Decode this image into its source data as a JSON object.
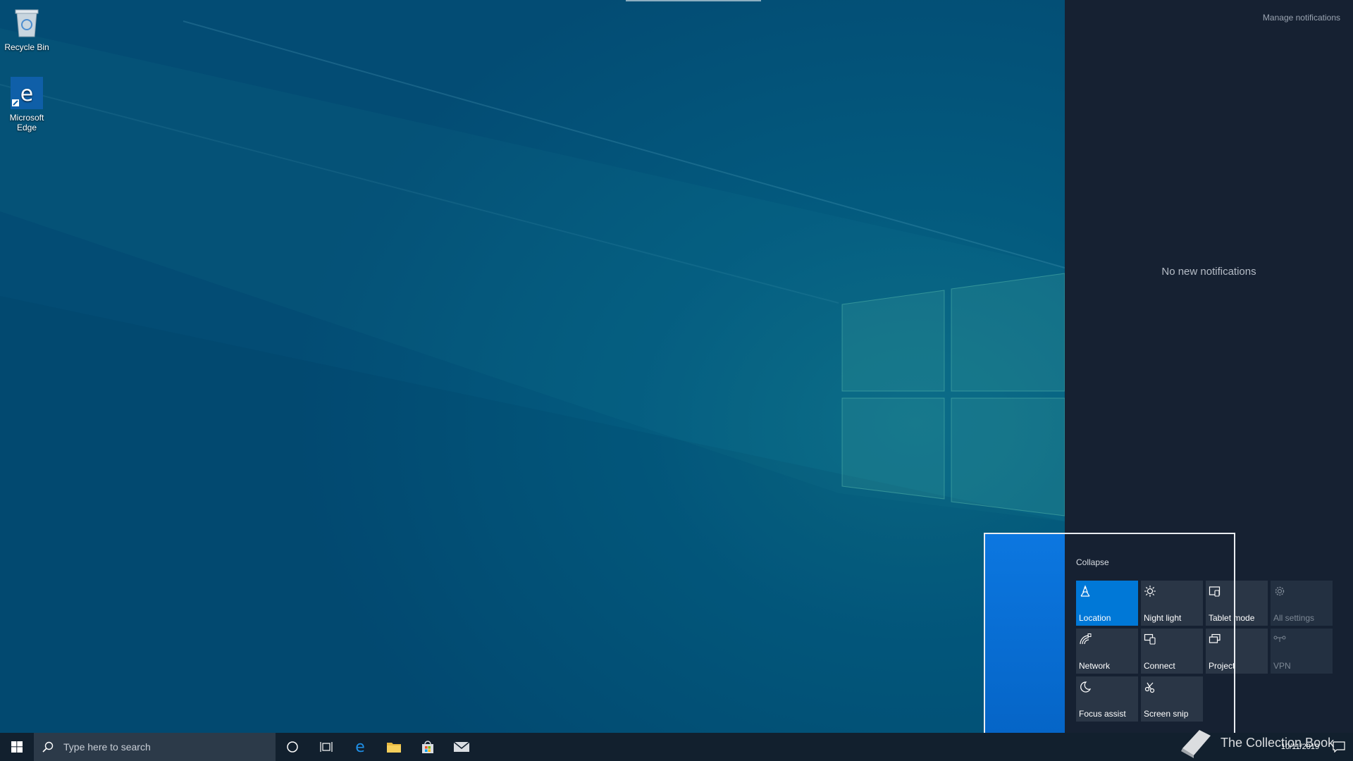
{
  "desktop": {
    "icons": [
      {
        "label": "Recycle Bin",
        "icon": "recycle-bin-icon"
      },
      {
        "label": "Microsoft Edge",
        "icon": "edge-icon"
      }
    ]
  },
  "action_center": {
    "manage_notifications": "Manage notifications",
    "no_notifications": "No new notifications",
    "collapse_label": "Collapse",
    "tiles": [
      {
        "label": "Location",
        "icon": "location-icon",
        "state": "on"
      },
      {
        "label": "Night light",
        "icon": "night-light-icon",
        "state": "off"
      },
      {
        "label": "Tablet mode",
        "icon": "tablet-mode-icon",
        "state": "off"
      },
      {
        "label": "All settings",
        "icon": "gear-icon",
        "state": "off"
      },
      {
        "label": "Network",
        "icon": "network-icon",
        "state": "off"
      },
      {
        "label": "Connect",
        "icon": "connect-icon",
        "state": "off"
      },
      {
        "label": "Project",
        "icon": "project-icon",
        "state": "off"
      },
      {
        "label": "VPN",
        "icon": "vpn-icon",
        "state": "off"
      },
      {
        "label": "Focus assist",
        "icon": "moon-icon",
        "state": "off"
      },
      {
        "label": "Screen snip",
        "icon": "screen-snip-icon",
        "state": "off"
      }
    ]
  },
  "taskbar": {
    "search_placeholder": "Type here to search",
    "pinned": [
      "cortana-icon",
      "task-view-icon",
      "edge-icon",
      "file-explorer-icon",
      "store-icon",
      "mail-icon"
    ],
    "clock_time": "",
    "clock_date": "10/11/2019"
  },
  "watermark": {
    "text": "The Collection Book"
  },
  "colors": {
    "accent": "#0078d7",
    "panel": "#162132",
    "taskbar": "#12202e"
  }
}
